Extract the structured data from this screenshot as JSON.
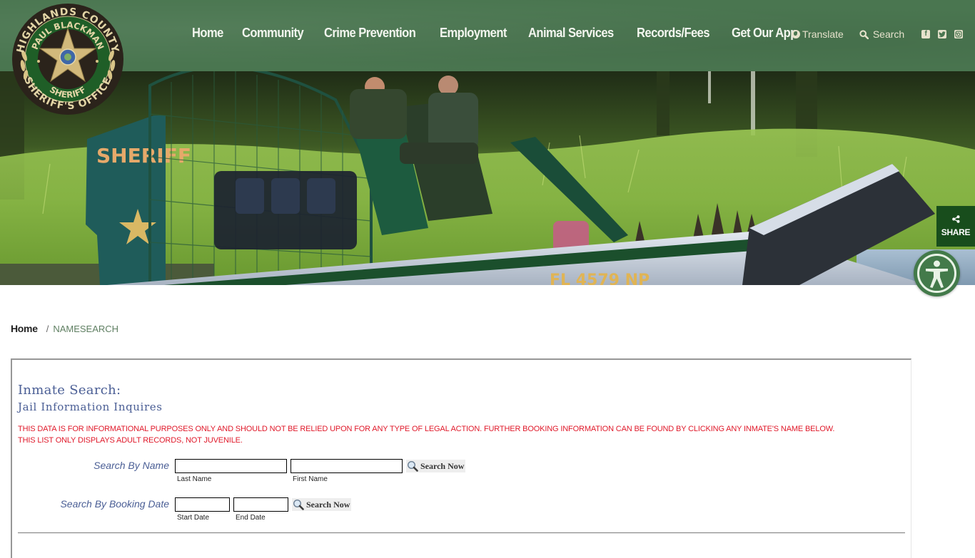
{
  "header": {
    "logo": {
      "ring_top": "HIGHLANDS COUNTY",
      "name_arc": "PAUL BLACKMAN",
      "badge_text": "SHERIFF",
      "ring_bottom": "SHERIFF'S OFFICE"
    },
    "nav": [
      {
        "label": "Home"
      },
      {
        "label": "Community"
      },
      {
        "label": "Crime Prevention"
      },
      {
        "label": "Employment"
      },
      {
        "label": "Animal Services"
      },
      {
        "label": "Records/Fees"
      },
      {
        "label": "Get Our App"
      }
    ],
    "translate_label": "Translate",
    "search_label": "Search",
    "social": [
      {
        "name": "facebook-icon",
        "glyph": "f"
      },
      {
        "name": "twitter-icon",
        "glyph": "t"
      },
      {
        "name": "instagram-icon",
        "glyph": "◎"
      }
    ]
  },
  "hero": {
    "boat_side_text": "SHERIFF",
    "registration": "FL 4579 NP"
  },
  "floating": {
    "share_label": "SHARE",
    "accessibility_label": "Accessibility"
  },
  "breadcrumb": {
    "home": "Home",
    "separator": "/",
    "current": "NAMESEARCH"
  },
  "panel": {
    "title": "Inmate Search:",
    "subtitle": "Jail Information Inquires",
    "warnings": [
      "THIS DATA IS FOR INFORMATIONAL PURPOSES ONLY AND SHOULD NOT BE RELIED UPON FOR ANY TYPE OF LEGAL ACTION. FURTHER BOOKING INFORMATION CAN BE FOUND BY CLICKING ANY INMATE'S NAME BELOW.",
      "THIS LIST ONLY DISPLAYS ADULT RECORDS, NOT JUVENILE."
    ],
    "name_search": {
      "label": "Search By Name",
      "last_name": {
        "value": "",
        "hint": "Last Name"
      },
      "first_name": {
        "value": "",
        "hint": "First Name"
      },
      "button": "Search Now"
    },
    "date_search": {
      "label": "Search By Booking Date",
      "start_date": {
        "value": "",
        "hint": "Start Date"
      },
      "end_date": {
        "value": "",
        "hint": "End Date"
      },
      "button": "Search Now"
    }
  },
  "colors": {
    "header_green": "#4a7650",
    "share_green": "#184d1c",
    "accessibility_green": "#437a4a",
    "heading_blue": "#4a5e95",
    "warning_red": "#e0192a",
    "breadcrumb_current": "#5f7f62"
  }
}
